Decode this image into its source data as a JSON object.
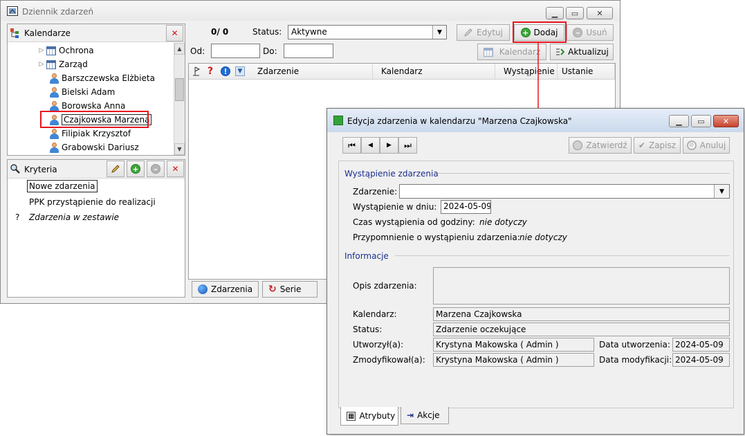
{
  "main_window": {
    "title": "Dziennik zdarzeń",
    "kalendarze_header": "Kalendarze",
    "counter": "0/ 0",
    "status_label": "Status:",
    "status_value": "Aktywne",
    "od_label": "Od:",
    "do_label": "Do:",
    "od_value": "",
    "do_value": "",
    "buttons": {
      "edytuj": "Edytuj",
      "dodaj": "Dodaj",
      "usun": "Usuń",
      "kalendarz": "Kalendarz",
      "aktualizuj": "Aktualizuj"
    },
    "tree_items": [
      {
        "label": "Ochrona",
        "type": "calendar-group"
      },
      {
        "label": "Zarząd",
        "type": "calendar-group"
      },
      {
        "label": "Barszczewska Elżbieta",
        "type": "person"
      },
      {
        "label": "Bielski Adam",
        "type": "person"
      },
      {
        "label": "Borowska Anna",
        "type": "person"
      },
      {
        "label": "Czajkowska Marzena",
        "type": "person",
        "selected": true
      },
      {
        "label": "Filipiak Krzysztof",
        "type": "person"
      },
      {
        "label": "Grabowski Dariusz",
        "type": "person"
      }
    ],
    "kryteria_header": "Kryteria",
    "kryteria_items": [
      {
        "label": "Nowe zdarzenia",
        "prefix": "",
        "italic": false,
        "selected": true
      },
      {
        "label": "PPK przystąpienie do realizacji",
        "prefix": "",
        "italic": false
      },
      {
        "label": "Zdarzenia w zestawie",
        "prefix": "?",
        "italic": true
      }
    ],
    "table_columns": [
      "Zdarzenie",
      "Kalendarz",
      "Wystąpienie",
      "Ustanie"
    ],
    "bottom_tabs": [
      "Zdarzenia",
      "Serie"
    ]
  },
  "dialog": {
    "title": "Edycja zdarzenia w kalendarzu \"Marzena Czajkowska\"",
    "buttons": {
      "zatwierdz": "Zatwierdź",
      "zapisz": "Zapisz",
      "anuluj": "Anuluj"
    },
    "section_wystapienie": "Wystąpienie zdarzenia",
    "zdarzenie_label": "Zdarzenie:",
    "zdarzenie_value": "",
    "wystapienie_label": "Wystąpienie w dniu:",
    "wystapienie_value": "2024-05-09",
    "czas_label": "Czas wystąpienia od godziny:",
    "czas_value": "nie dotyczy",
    "przypomnienie_label": "Przypomnienie o wystąpieniu zdarzenia:",
    "przypomnienie_value": "nie dotyczy",
    "section_informacje": "Informacje",
    "opis_label": "Opis zdarzenia:",
    "opis_value": "",
    "kalendarz_label": "Kalendarz:",
    "kalendarz_value": "Marzena Czajkowska",
    "status_label": "Status:",
    "status_value": "Zdarzenie oczekujące",
    "utworzyl_label": "Utworzył(a):",
    "utworzyl_value": "Krystyna Makowska ( Admin )",
    "data_utworzenia_label": "Data utworzenia:",
    "data_utworzenia_value": "2024-05-09",
    "zmodyfikowal_label": "Zmodyfikował(a):",
    "zmodyfikowal_value": "Krystyna Makowska ( Admin )",
    "data_modyfikacji_label": "Data modyfikacji:",
    "data_modyfikacji_value": "2024-05-09",
    "tabs": [
      "Atrybuty",
      "Akcje"
    ]
  },
  "colors": {
    "highlight": "#e8141d",
    "group_title": "#1b2f8c",
    "add_green": "#3aa637"
  }
}
